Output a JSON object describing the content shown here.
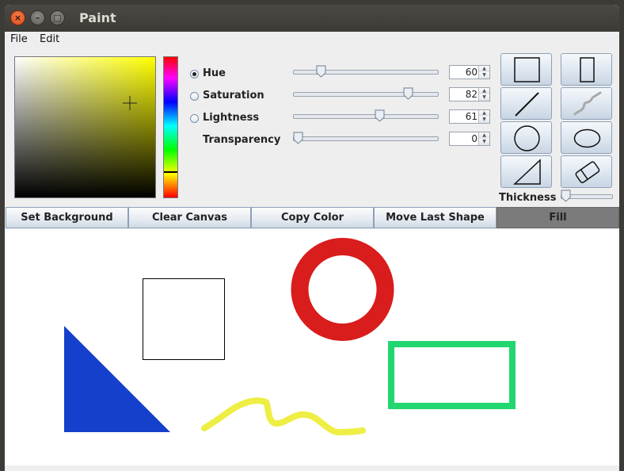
{
  "window": {
    "title": "Paint"
  },
  "menu": {
    "items": [
      "File",
      "Edit"
    ]
  },
  "properties": {
    "hue": {
      "label": "Hue",
      "value": "60",
      "level": 0.17,
      "selected": true
    },
    "saturation": {
      "label": "Saturation",
      "value": "82",
      "level": 0.82,
      "selected": false
    },
    "lightness": {
      "label": "Lightness",
      "value": "61",
      "level": 0.61,
      "selected": false
    },
    "transparency": {
      "label": "Transparency",
      "value": "0",
      "level": 0.0
    }
  },
  "tools": [
    "rectangle-tool",
    "tall-rectangle-tool",
    "line-tool",
    "freehand-tool",
    "circle-tool",
    "ellipse-tool",
    "triangle-tool",
    "eraser-tool"
  ],
  "thickness": {
    "label": "Thickness",
    "level": 0.0
  },
  "actions": {
    "set_background": "Set Background",
    "clear_canvas": "Clear Canvas",
    "copy_color": "Copy Color",
    "move_last_shape": "Move Last Shape",
    "fill": "Fill"
  },
  "canvas": {
    "shape_colors": {
      "triangle": "#1540cc",
      "rectangle_outline": "#000000",
      "ring": "#d91c1c",
      "green_rect": "#22d670",
      "squiggle": "#eeee44"
    }
  }
}
